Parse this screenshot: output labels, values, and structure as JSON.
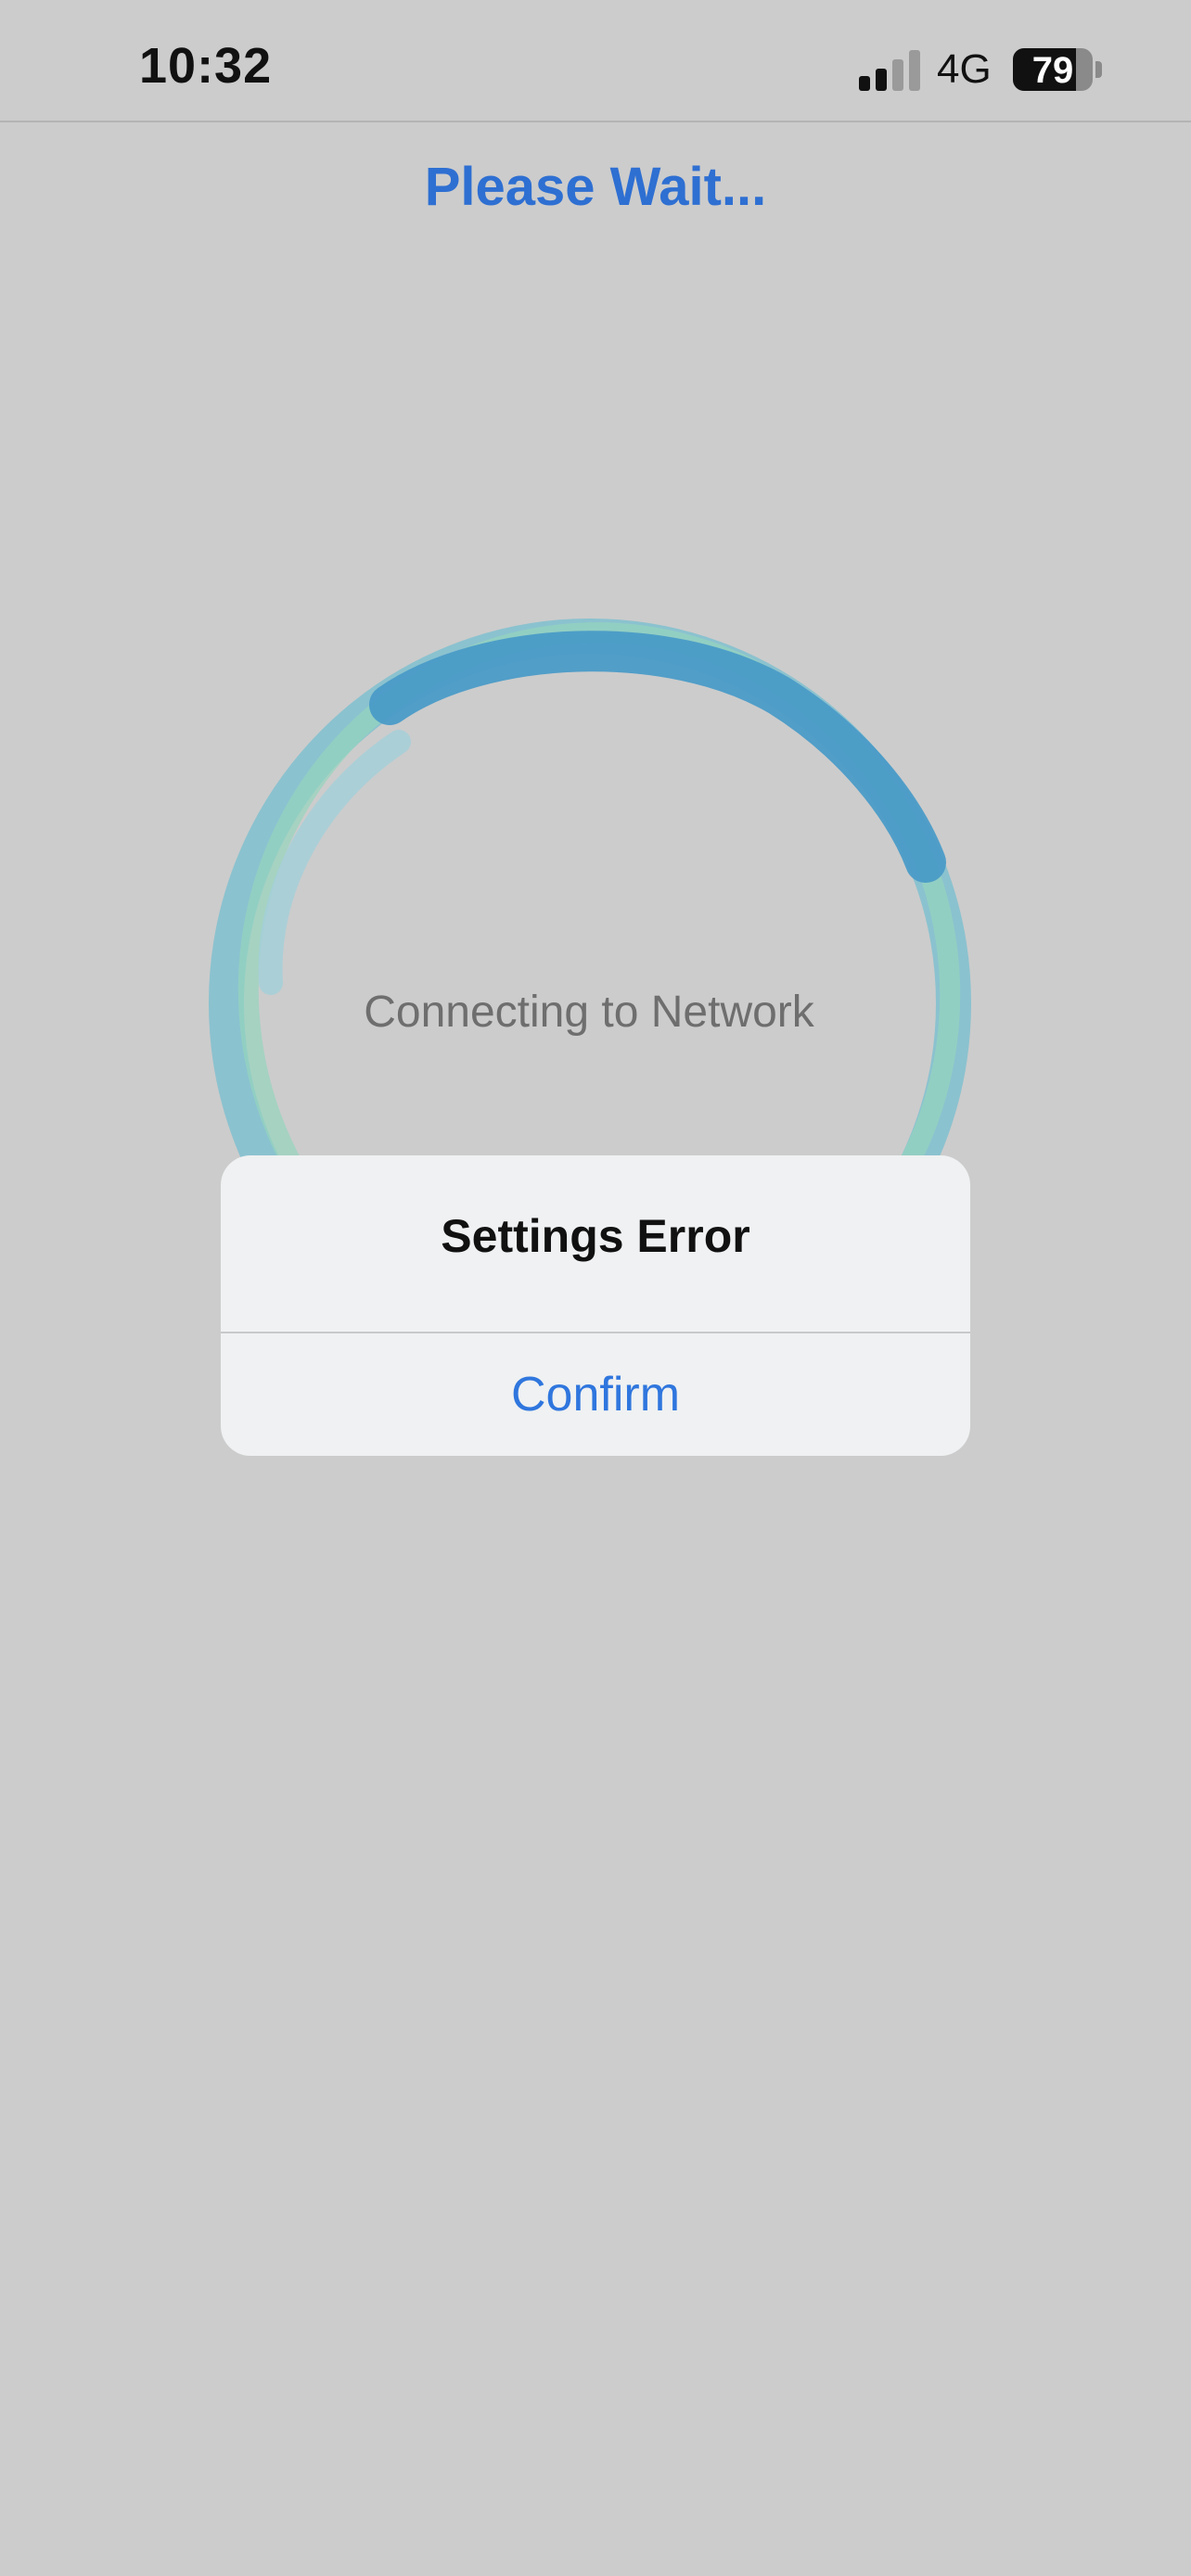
{
  "status_bar": {
    "time": "10:32",
    "network": "4G",
    "battery_level": "79",
    "battery_fraction": 0.79,
    "signal_icon": "cellular-signal-icon",
    "signal_bars_active": 2,
    "signal_bars_total": 4
  },
  "header": {
    "title": "Please Wait..."
  },
  "loader": {
    "status_text": "Connecting to Network"
  },
  "alert": {
    "title": "Settings Error",
    "confirm_label": "Confirm"
  },
  "colors": {
    "background": "#cccccc",
    "accent": "#2e6fd2",
    "ring_blue": "#4a9bc7",
    "ring_teal": "#7fc0cf",
    "ring_green": "#96d4bd",
    "alert_background": "#eff1f2"
  }
}
